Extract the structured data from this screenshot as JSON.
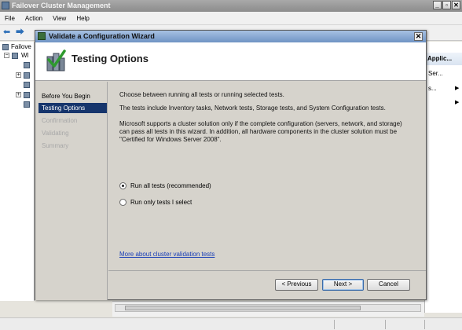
{
  "background_window": {
    "title": "Failover Cluster Management",
    "menu": [
      "File",
      "Action",
      "View",
      "Help"
    ],
    "tree": {
      "root_label": "Failove",
      "child_label": "WI"
    },
    "actions_pane": {
      "header": "Applic...",
      "items": [
        "Ser...",
        "s...",
        ""
      ]
    }
  },
  "wizard": {
    "title": "Validate a Configuration Wizard",
    "header_title": "Testing Options",
    "nav": [
      {
        "label": "Before You Begin",
        "state": "normal"
      },
      {
        "label": "Testing Options",
        "state": "active"
      },
      {
        "label": "Confirmation",
        "state": "disabled"
      },
      {
        "label": "Validating",
        "state": "disabled"
      },
      {
        "label": "Summary",
        "state": "disabled"
      }
    ],
    "paragraphs": {
      "p1": "Choose between running all tests or running selected tests.",
      "p2": "The tests include Inventory tasks, Network tests, Storage tests, and System Configuration tests.",
      "p3": "Microsoft supports a cluster solution only if the complete configuration (servers, network, and storage) can pass all tests in this wizard. In addition, all hardware components in the cluster solution must be \"Certified for Windows Server 2008\"."
    },
    "options": {
      "run_all": "Run all tests (recommended)",
      "run_selected": "Run only tests I select",
      "selected": "run_all"
    },
    "link": "More about cluster validation tests",
    "buttons": {
      "previous": "< Previous",
      "next": "Next >",
      "cancel": "Cancel"
    }
  }
}
